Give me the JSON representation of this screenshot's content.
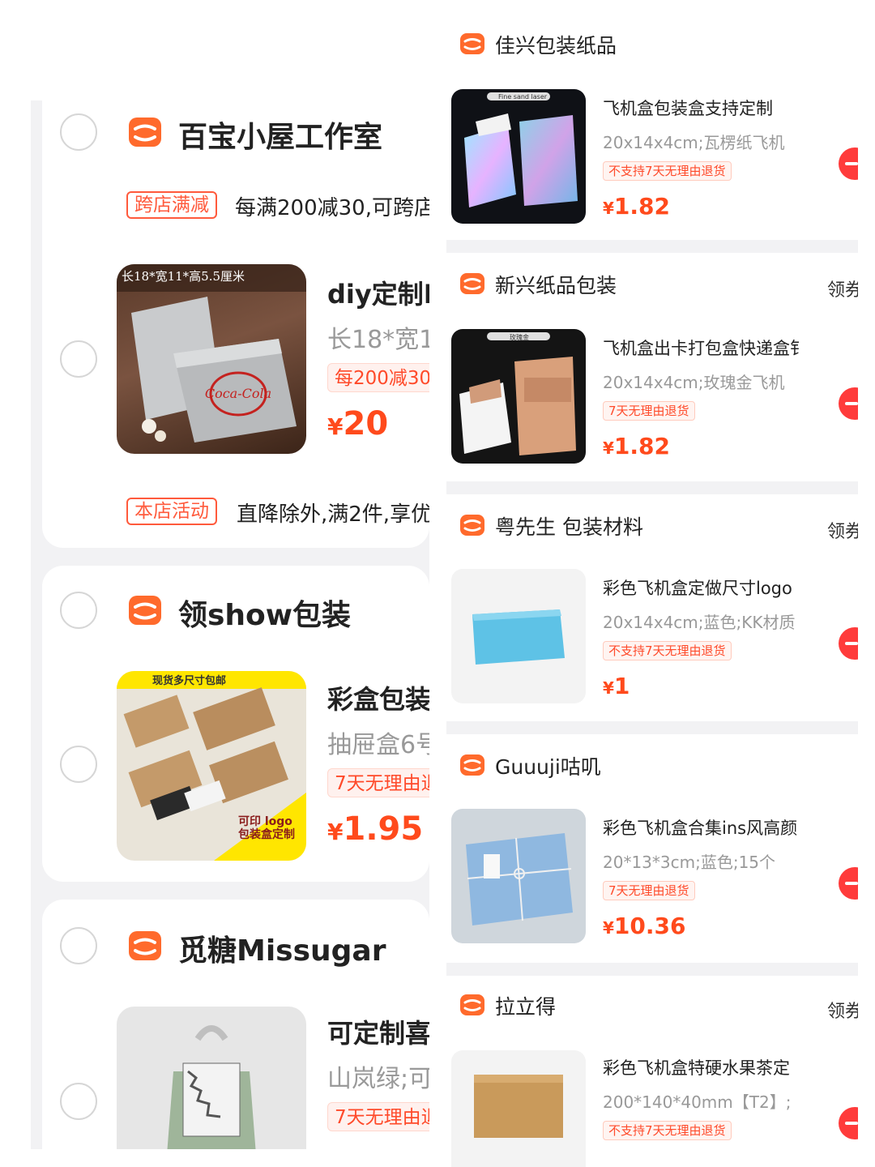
{
  "left_panel": {
    "stores": [
      {
        "name": "百宝小屋工作室",
        "cross_promo": {
          "tag": "跨店满减",
          "text": "每满200减30,可跨店"
        },
        "product": {
          "thumb_text": "长18*宽11*高5.5厘米",
          "title": "diy定制E",
          "spec": "长18*宽1",
          "badge": "每200减30",
          "price_currency": "¥",
          "price_amount": "20"
        },
        "shop_promo": {
          "tag": "本店活动",
          "text": "直降除外,满2件,享优"
        }
      },
      {
        "name": "领show包装",
        "product": {
          "thumb_banner": "现货多尺寸包邮",
          "thumb_note": "可印 logo 包装盒定制",
          "title": "彩盒包装",
          "spec": "抽屉盒6号",
          "badge": "7天无理由退",
          "price_currency": "¥",
          "price_amount": "1.95"
        }
      },
      {
        "name": "觅糖Missugar",
        "product": {
          "title": "可定制喜",
          "spec": "山岚绿;可",
          "badge": "7天无理由退"
        }
      }
    ]
  },
  "right_panel": {
    "coupon_label": "领券",
    "stores": [
      {
        "name": "佳兴包装纸品",
        "show_coupon": false,
        "product": {
          "thumb_label": "Fine sand laser",
          "title": "飞机盒包装盒支持定制",
          "spec": "20x14x4cm;瓦楞纸飞机",
          "badge": "不支持7天无理由退货",
          "price_currency": "¥",
          "price_amount": "1.82"
        }
      },
      {
        "name": "新兴纸品包装",
        "show_coupon": true,
        "product": {
          "thumb_label": "玫瑰金",
          "title": "飞机盒出卡打包盒快递盒钅",
          "spec": "20x14x4cm;玫瑰金飞机",
          "badge": "7天无理由退货",
          "price_currency": "¥",
          "price_amount": "1.82"
        }
      },
      {
        "name": "粤先生  包装材料",
        "show_coupon": true,
        "product": {
          "title": "彩色飞机盒定做尺寸logo",
          "spec": "20x14x4cm;蓝色;KK材质",
          "badge": "不支持7天无理由退货",
          "price_currency": "¥",
          "price_amount": "1"
        }
      },
      {
        "name": "Guuuji咕叽",
        "show_coupon": false,
        "product": {
          "title": "彩色飞机盒合集ins风高颜",
          "spec": "20*13*3cm;蓝色;15个",
          "badge": "7天无理由退货",
          "price_currency": "¥",
          "price_amount": "10.36"
        }
      },
      {
        "name": "拉立得",
        "show_coupon": true,
        "product": {
          "title": "彩色飞机盒特硬水果茶定",
          "spec": "200*140*40mm【T2】;",
          "badge": "不支持7天无理由退货"
        }
      }
    ]
  },
  "colors": {
    "accent": "#ff5a1f",
    "price": "#ff4a1c",
    "badge_text": "#ff4a2a",
    "separator": "#f2f2f4",
    "remove_button": "#ff3b3b"
  },
  "icons": {
    "store": "store-icon",
    "checkbox": "radio-circle",
    "remove": "minus-circle-icon"
  }
}
